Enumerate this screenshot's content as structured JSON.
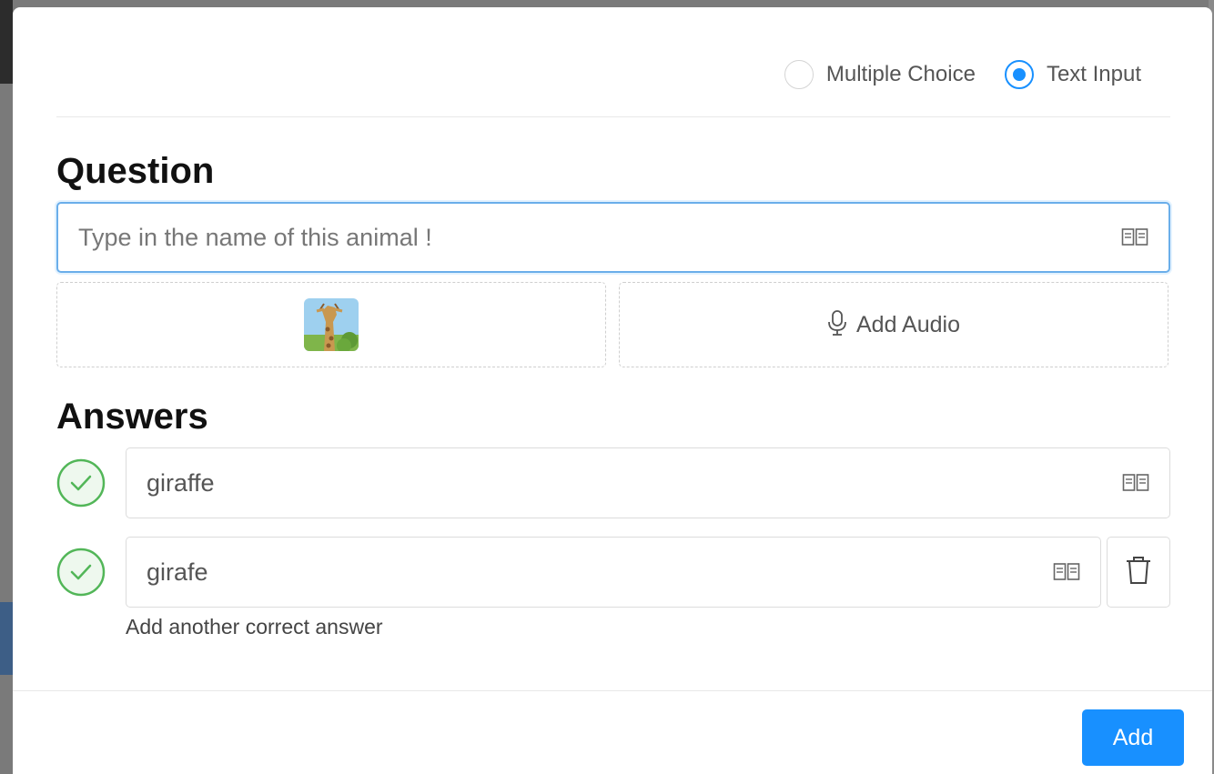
{
  "question_type": {
    "options": [
      {
        "label": "Multiple Choice",
        "selected": false
      },
      {
        "label": "Text Input",
        "selected": true
      }
    ]
  },
  "question": {
    "title": "Question",
    "text": "Type in the name of this animal !",
    "dictionary_icon": "book-icon",
    "image_icon": "giraffe-image",
    "audio_label": "Add Audio",
    "audio_icon": "microphone-icon"
  },
  "answers": {
    "title": "Answers",
    "items": [
      {
        "value": "giraffe",
        "correct": true
      },
      {
        "value": "girafe",
        "correct": true
      }
    ],
    "add_another_label": "Add another correct answer",
    "delete_icon": "trash-icon"
  },
  "footer": {
    "add_label": "Add"
  },
  "colors": {
    "accent": "#1890ff",
    "correct": "#52b658"
  }
}
